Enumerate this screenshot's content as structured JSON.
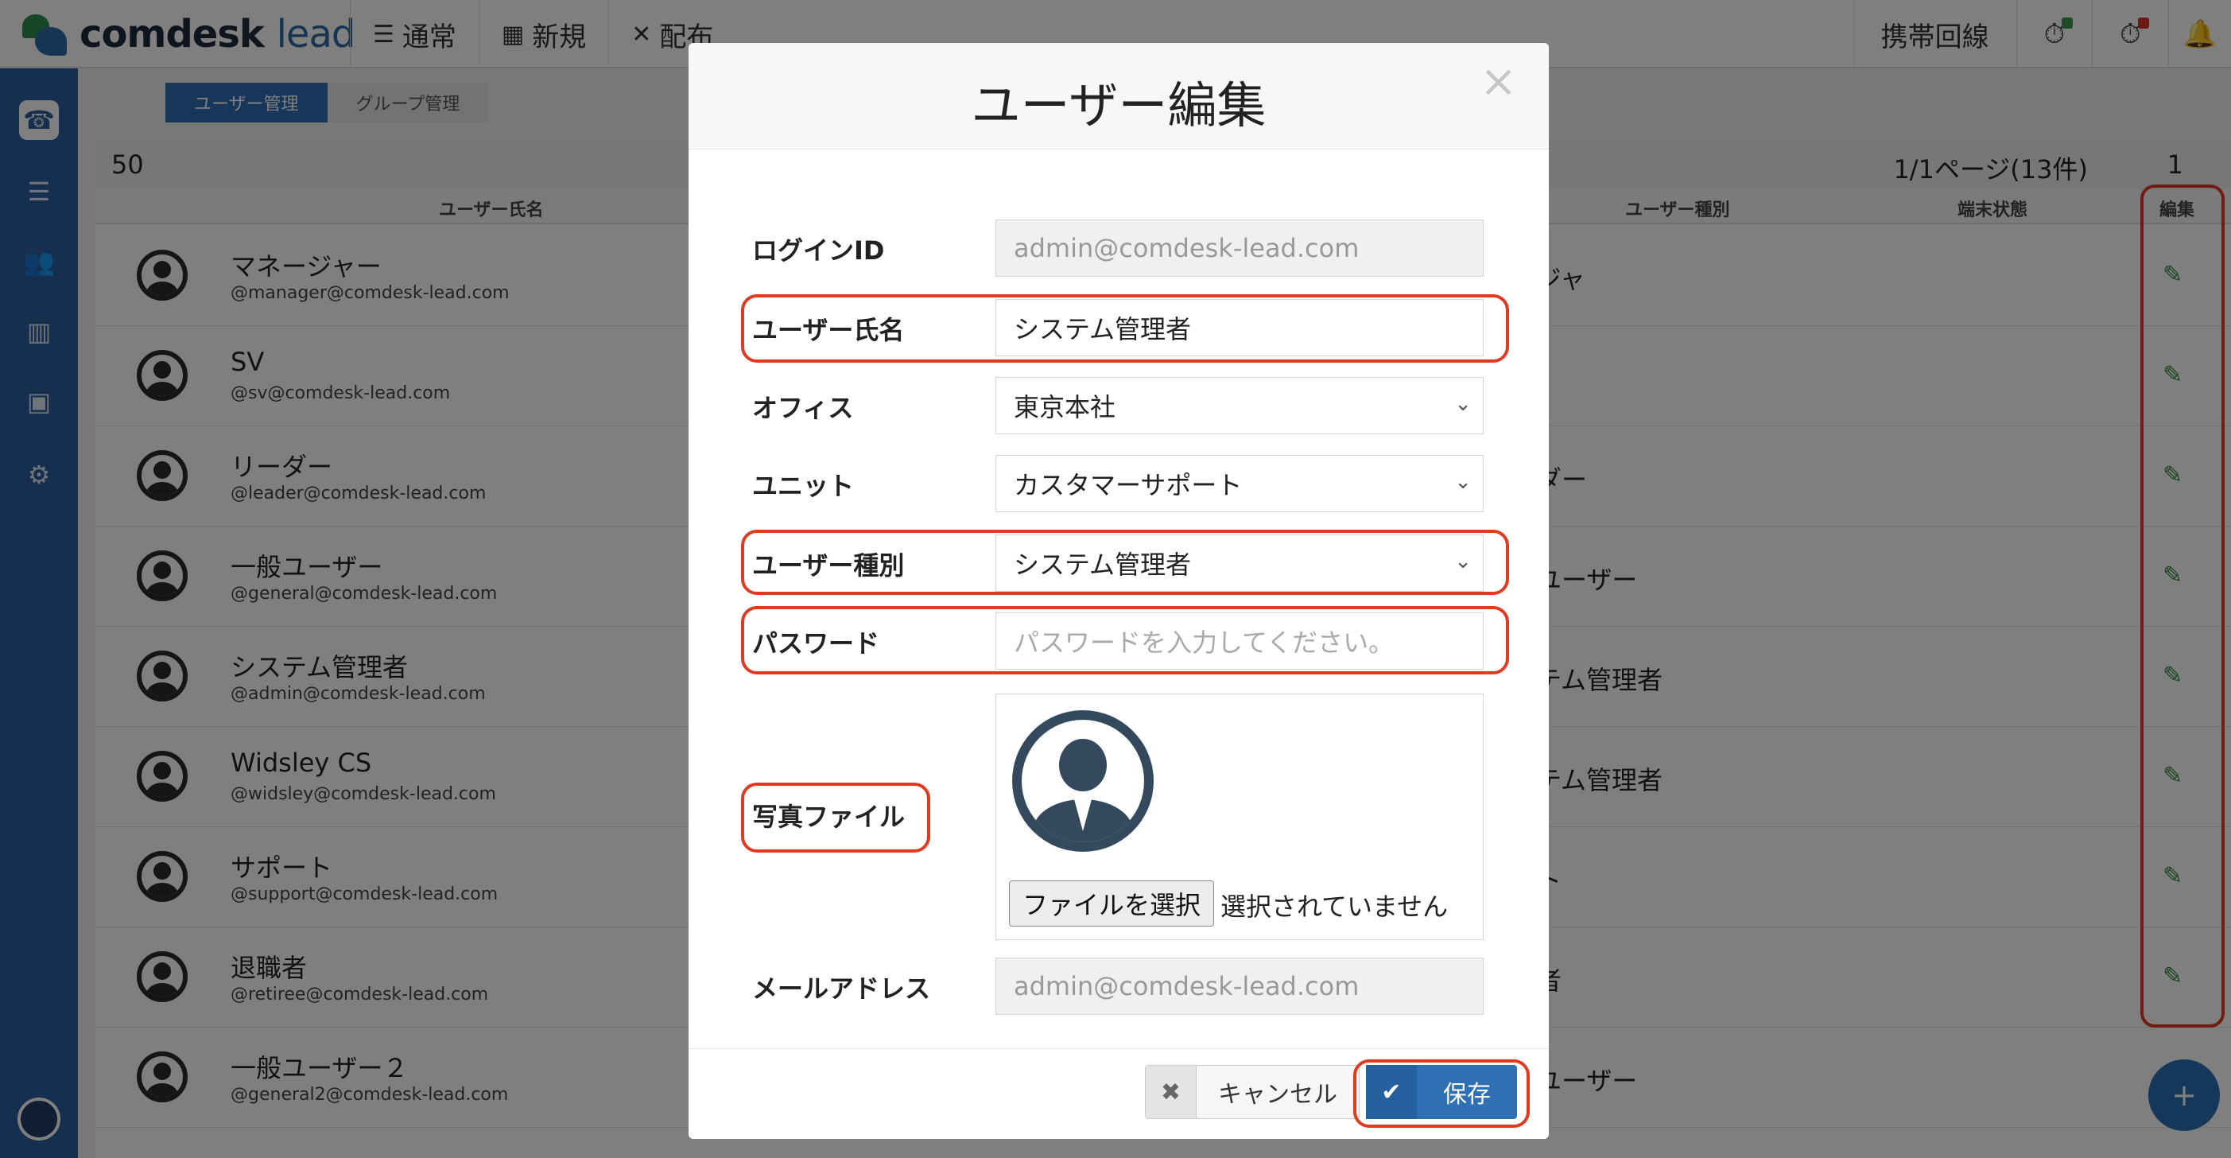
{
  "app": {
    "brand_main": "comdesk",
    "brand_accent": "lead",
    "nav": [
      {
        "icon": "list-icon",
        "label": "通常"
      },
      {
        "icon": "grid-icon",
        "label": "新規"
      },
      {
        "icon": "shuffle-icon",
        "label": "配布"
      }
    ],
    "right": {
      "mobile_label": "携帯回線"
    }
  },
  "subtabs": [
    "ユーザー管理",
    "グループ管理"
  ],
  "list": {
    "per_page": "50",
    "paging": "1/1ページ(13件)",
    "page_no": "1",
    "headers": {
      "name": "ユーザー氏名",
      "type": "ユーザー種別",
      "status": "端末状態",
      "edit": "編集"
    },
    "rows": [
      {
        "name": "マネージャー",
        "email": "@manager@comdesk-lead.com",
        "type_visible": "ージャ"
      },
      {
        "name": "SV",
        "email": "@sv@comdesk-lead.com",
        "type_visible": ""
      },
      {
        "name": "リーダー",
        "email": "@leader@comdesk-lead.com",
        "type_visible": "ーダー"
      },
      {
        "name": "一般ユーザー",
        "email": "@general@comdesk-lead.com",
        "type_visible": "役ユーザー"
      },
      {
        "name": "システム管理者",
        "email": "@admin@comdesk-lead.com",
        "type_visible": "ステム管理者"
      },
      {
        "name": "Widsley CS",
        "email": "@widsley@comdesk-lead.com",
        "type_visible": "ステム管理者"
      },
      {
        "name": "サポート",
        "email": "@support@comdesk-lead.com",
        "type_visible": "ート"
      },
      {
        "name": "退職者",
        "email": "@retiree@comdesk-lead.com",
        "type_visible": "職者"
      },
      {
        "name": "一般ユーザー２",
        "email": "@general2@comdesk-lead.com",
        "type_visible": "役ユーザー"
      }
    ]
  },
  "modal": {
    "title": "ユーザー編集",
    "fields": {
      "login_id": {
        "label": "ログインID",
        "value": "admin@comdesk-lead.com"
      },
      "user_name": {
        "label": "ユーザー氏名",
        "value": "システム管理者"
      },
      "office": {
        "label": "オフィス",
        "value": "東京本社"
      },
      "unit": {
        "label": "ユニット",
        "value": "カスタマーサポート"
      },
      "user_type": {
        "label": "ユーザー種別",
        "value": "システム管理者"
      },
      "password": {
        "label": "パスワード",
        "placeholder": "パスワードを入力してください。"
      },
      "photo": {
        "label": "写真ファイル",
        "button": "ファイルを選択",
        "status": "選択されていません"
      },
      "email": {
        "label": "メールアドレス",
        "value": "admin@comdesk-lead.com"
      }
    },
    "cancel_label": "キャンセル",
    "save_label": "保存"
  },
  "colors": {
    "sidebar": "#2d5f9e",
    "primary": "#2f6fb3",
    "annotation": "#e03a22",
    "edit_icon": "#2e8b3a"
  }
}
